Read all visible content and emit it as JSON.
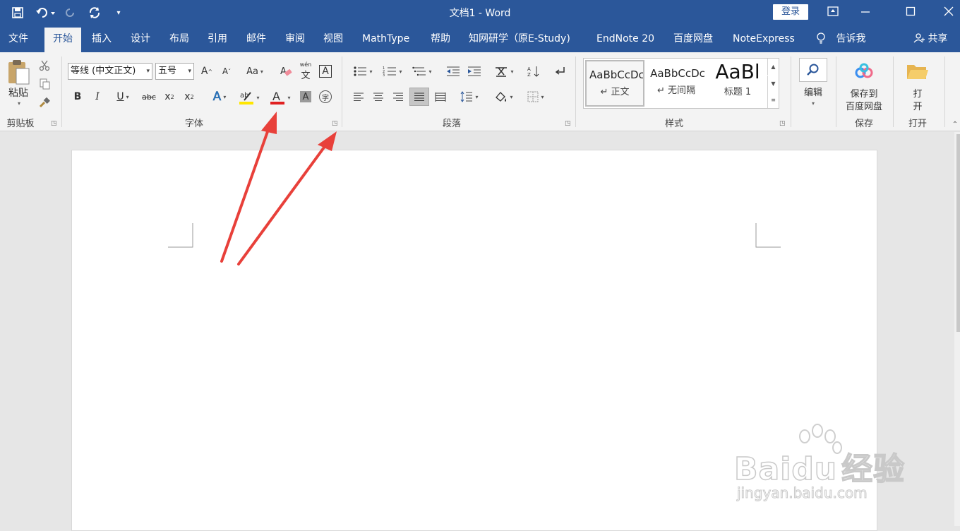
{
  "window": {
    "title": "文档1  -  Word",
    "login_label": "登录"
  },
  "quick_access": {
    "save": "save-icon",
    "undo": "undo-icon",
    "redo": "redo-icon",
    "repeat": "repeat-icon",
    "customize": "customize-icon"
  },
  "tabs": [
    {
      "label": "文件"
    },
    {
      "label": "开始"
    },
    {
      "label": "插入"
    },
    {
      "label": "设计"
    },
    {
      "label": "布局"
    },
    {
      "label": "引用"
    },
    {
      "label": "邮件"
    },
    {
      "label": "审阅"
    },
    {
      "label": "视图"
    },
    {
      "label": "MathType"
    },
    {
      "label": "帮助"
    },
    {
      "label": "知网研学（原E-Study)"
    },
    {
      "label": "EndNote 20"
    },
    {
      "label": "百度网盘"
    },
    {
      "label": "NoteExpress"
    }
  ],
  "tellme": "告诉我",
  "share": "共享",
  "clipboard": {
    "paste": "粘贴",
    "group": "剪贴板"
  },
  "font": {
    "name": "等线 (中文正文)",
    "size": "五号",
    "grow": "A",
    "shrink": "A",
    "case": "Aa",
    "phonetic": "wén",
    "border_char": "A",
    "bold": "B",
    "italic": "I",
    "underline": "U",
    "strike": "abc",
    "sub": "x",
    "sup": "x",
    "effects": "A",
    "font_color": "A",
    "shade": "A",
    "enclose": "字",
    "group": "字体"
  },
  "paragraph": {
    "group": "段落"
  },
  "styles": {
    "group": "样式",
    "items": [
      {
        "preview": "AaBbCcDc",
        "name": "↵ 正文"
      },
      {
        "preview": "AaBbCcDc",
        "name": "↵ 无间隔"
      },
      {
        "preview": "AaBl",
        "name": "标题 1"
      }
    ]
  },
  "editing": {
    "label": "编辑"
  },
  "baidu_save": {
    "line1": "保存到",
    "line2": "百度网盘",
    "group": "保存"
  },
  "open": {
    "line1": "打",
    "line2": "开",
    "group": "打开"
  },
  "watermark": {
    "brand": "Bai",
    "brand2": "du",
    "brand_cn": "经验",
    "url": "jingyan.baidu.com"
  },
  "colors": {
    "accent": "#2b579a",
    "ribbon": "#f3f3f3",
    "arrow": "#e8403a",
    "font_red": "#e02020",
    "highlight": "#ffe600"
  }
}
